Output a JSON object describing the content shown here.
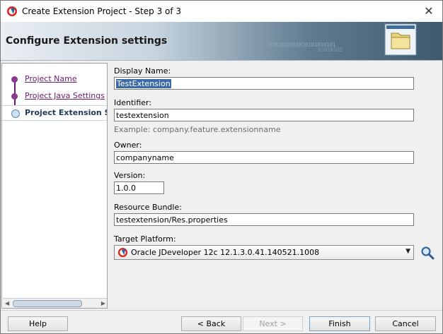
{
  "window": {
    "title": "Create Extension Project - Step 3 of 3"
  },
  "banner": {
    "heading": "Configure Extension settings",
    "binary_line1": "0101010101010101010101",
    "binary_line2": "01010101"
  },
  "steps": [
    {
      "label": "Project Name",
      "state": "completed"
    },
    {
      "label": "Project Java Settings",
      "state": "completed"
    },
    {
      "label": "Project Extension Settings",
      "state": "current"
    }
  ],
  "form": {
    "display_name": {
      "label": "Display Name:",
      "value": "TestExtension"
    },
    "identifier": {
      "label": "Identifier:",
      "value": "testextension",
      "hint": "Example: company.feature.extensionname"
    },
    "owner": {
      "label": "Owner:",
      "value": "companyname"
    },
    "version": {
      "label": "Version:",
      "value": "1.0.0"
    },
    "resource_bundle": {
      "label": "Resource Bundle:",
      "value": "testextension/Res.properties"
    },
    "target_platform": {
      "label": "Target Platform:",
      "value": "Oracle JDeveloper 12c 12.1.3.0.41.140521.1008"
    }
  },
  "buttons": {
    "help": "Help",
    "back": "< Back",
    "next": "Next >",
    "finish": "Finish",
    "cancel": "Cancel"
  },
  "colors": {
    "link": "#6a1b6e",
    "selection": "#3b6aa6",
    "current_step": "#1f3a5a"
  },
  "icons": {
    "app": "oracle-jdeveloper-icon",
    "banner": "folder-icon",
    "search": "magnifier-icon",
    "close": "close-icon"
  }
}
